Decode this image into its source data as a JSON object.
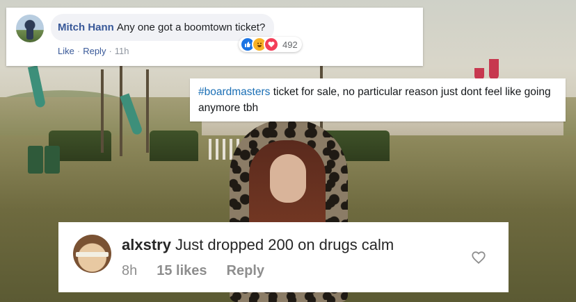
{
  "facebook_comment": {
    "author": "Mitch Hann",
    "text": "Any one got a boomtown ticket?",
    "like_label": "Like",
    "reply_label": "Reply",
    "time": "11h",
    "reaction_count": "492",
    "reactions": [
      "like-icon",
      "haha-icon",
      "love-icon"
    ]
  },
  "tweet": {
    "hashtag": "#boardmasters",
    "text": " ticket for sale, no particular reason just dont feel like going anymore tbh"
  },
  "instagram_comment": {
    "username": "alxstry",
    "text": "Just dropped 200 on drugs calm",
    "time": "8h",
    "likes": "15 likes",
    "reply_label": "Reply",
    "heart_icon": "heart-icon"
  },
  "colors": {
    "facebook_link": "#385898",
    "hashtag": "#1b6fb5",
    "instagram_meta": "#8e8e8e"
  }
}
